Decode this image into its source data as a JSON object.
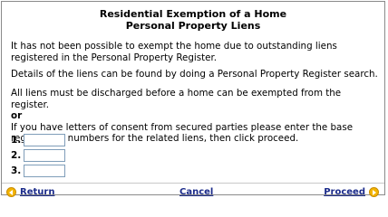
{
  "header": {
    "title_line1": "Residential Exemption of a Home",
    "title_line2": "Personal Property Liens"
  },
  "content": {
    "para1": "It has not been possible to exempt the home due to outstanding liens registered in the Personal Property Register.",
    "para2": "Details of the liens can be found by doing a Personal Property Register search.",
    "para3": "All liens must be discharged before a home can be exempted from the register.",
    "or_label": "or",
    "para4": "If you have letters of consent from secured parties please enter the base registration numbers for the related liens, then click proceed."
  },
  "form": {
    "rows": [
      {
        "label": "1.",
        "value": ""
      },
      {
        "label": "2.",
        "value": ""
      },
      {
        "label": "3.",
        "value": ""
      }
    ]
  },
  "footer": {
    "return_label": "Return",
    "cancel_label": "Cancel",
    "proceed_label": "Proceed",
    "return_icon": "arrow-left-circle-icon",
    "proceed_icon": "arrow-right-circle-icon",
    "icon_color": "#f3b400",
    "link_color": "#1b2b8a"
  }
}
